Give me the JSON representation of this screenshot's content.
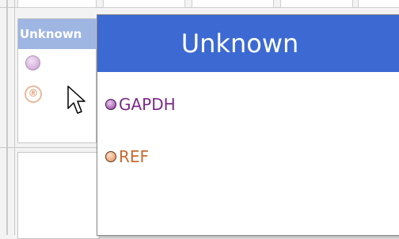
{
  "tile": {
    "header": "Unknown",
    "symbol_reg": "®"
  },
  "popup": {
    "title": "Unknown",
    "items": [
      {
        "label": "GAPDH",
        "color": "#7a2a86",
        "marker": "circle-purple"
      },
      {
        "label": "REF",
        "color": "#c86a2c",
        "marker": "circle-orange"
      }
    ]
  },
  "colors": {
    "header_blue": "#3c6ad2",
    "tile_header": "#9fb5e2"
  }
}
